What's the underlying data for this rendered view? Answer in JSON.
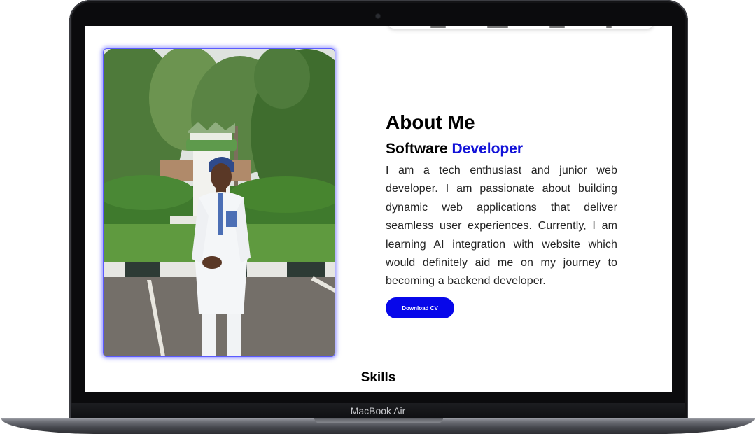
{
  "device": {
    "model_label": "MacBook Air"
  },
  "profile": {
    "photo_icon": "portrait-photo"
  },
  "about": {
    "title": "About Me",
    "subtitle_prefix": "Software",
    "subtitle_accent": "Developer",
    "paragraph": "I am a tech enthusiast and junior web developer. I am passionate about building dynamic web applications that deliver seamless user experiences. Currently, I am learning AI integration with website which would definitely aid me on my journey to becoming a backend developer.",
    "button_label": "Download CV"
  },
  "skills": {
    "heading": "Skills"
  },
  "colors": {
    "accent": "#1212d8",
    "button": "#0707ea",
    "photo_glow": "#5b5bff"
  }
}
